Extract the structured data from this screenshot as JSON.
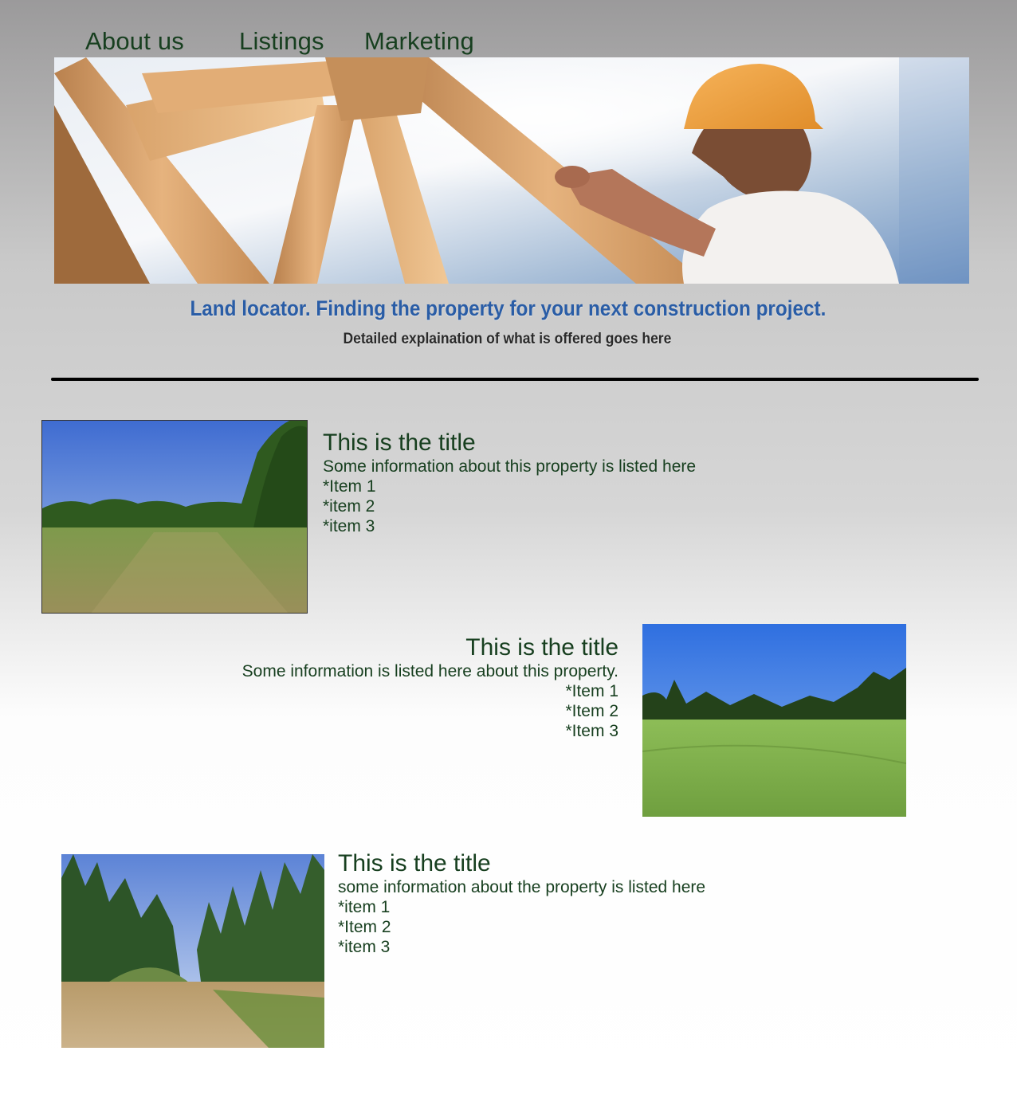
{
  "nav": {
    "items": [
      {
        "label": "About us"
      },
      {
        "label": "Listings"
      },
      {
        "label": "Marketing"
      }
    ]
  },
  "header": {
    "tagline": "Land locator. Finding the property for your next construction project.",
    "detail": "Detailed explaination of what is offered goes here"
  },
  "listings": [
    {
      "title": "This is the title",
      "info": "Some information about this property is listed here",
      "items": [
        "*Item 1",
        "*item 2",
        "*item 3"
      ]
    },
    {
      "title": "This is the title",
      "info": "Some information is listed here about this property.",
      "items": [
        "*Item 1",
        "*Item 2",
        "*Item 3"
      ]
    },
    {
      "title": "This is the title",
      "info": "some information about the property is listed here",
      "items": [
        "*item 1",
        "*Item 2",
        "*item 3"
      ]
    }
  ],
  "colors": {
    "nav_text": "#173f1f",
    "tagline": "#2a5da6",
    "detail": "#2a2a2a",
    "listing_text": "#173f1f"
  }
}
